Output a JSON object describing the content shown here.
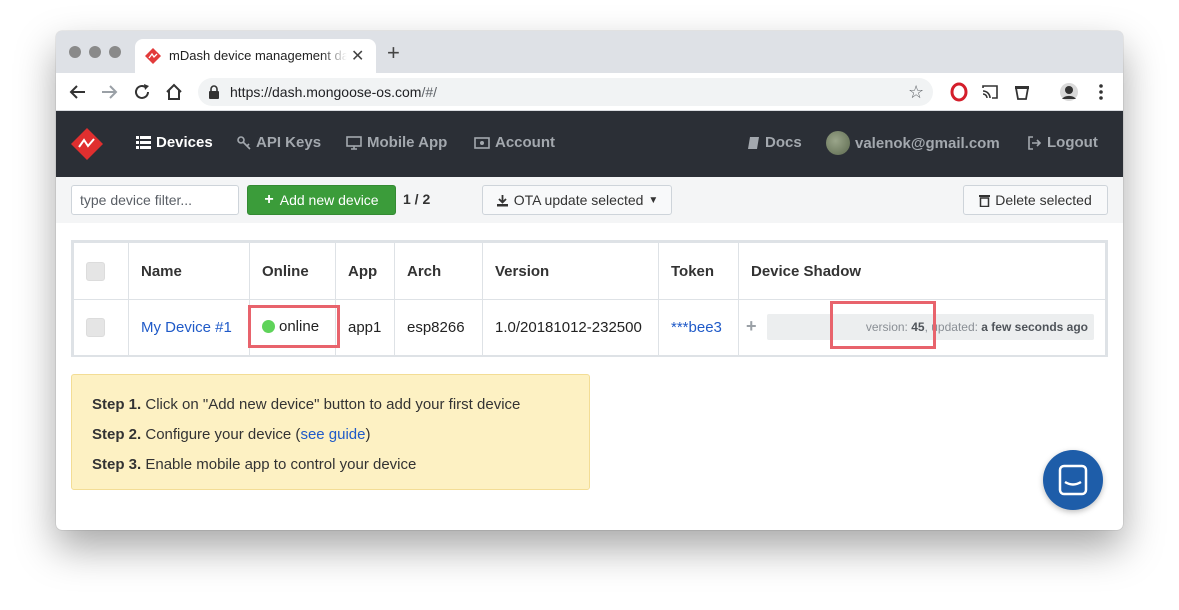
{
  "browser": {
    "tab_title": "mDash device management da",
    "url_host": "https://dash.mongoose-os.com",
    "url_path": "/#/"
  },
  "nav": {
    "devices": "Devices",
    "api_keys": "API Keys",
    "mobile_app": "Mobile App",
    "account": "Account",
    "docs": "Docs",
    "user": "valenok@gmail.com",
    "logout": "Logout"
  },
  "actions": {
    "filter_placeholder": "type device filter...",
    "add_device": "Add new device",
    "count": "1 / 2",
    "ota": "OTA update selected",
    "delete": "Delete selected"
  },
  "table": {
    "headers": [
      "Name",
      "Online",
      "App",
      "Arch",
      "Version",
      "Token",
      "Device Shadow"
    ],
    "rows": [
      {
        "name": "My Device #1",
        "online": "online",
        "app": "app1",
        "arch": "esp8266",
        "version": "1.0/20181012-232500",
        "token": "***bee3",
        "shadow_version_label": "version: ",
        "shadow_version": "45",
        "shadow_updated_label": ", updated: ",
        "shadow_updated": "a few seconds ago"
      }
    ]
  },
  "steps": [
    {
      "label": "Step 1.",
      "text": " Click on \"Add new device\" button to add your first device"
    },
    {
      "label": "Step 2.",
      "text": " Configure your device (",
      "link": "see guide",
      "after": ")"
    },
    {
      "label": "Step 3.",
      "text": " Enable mobile app to control your device"
    }
  ],
  "colors": {
    "navbar": "#2b2f36",
    "add_button": "#3b9c3a",
    "online_dot": "#5fd35a",
    "highlight": "#e8636c",
    "steps_bg": "#fdf1c3",
    "chat": "#1e5da9"
  }
}
